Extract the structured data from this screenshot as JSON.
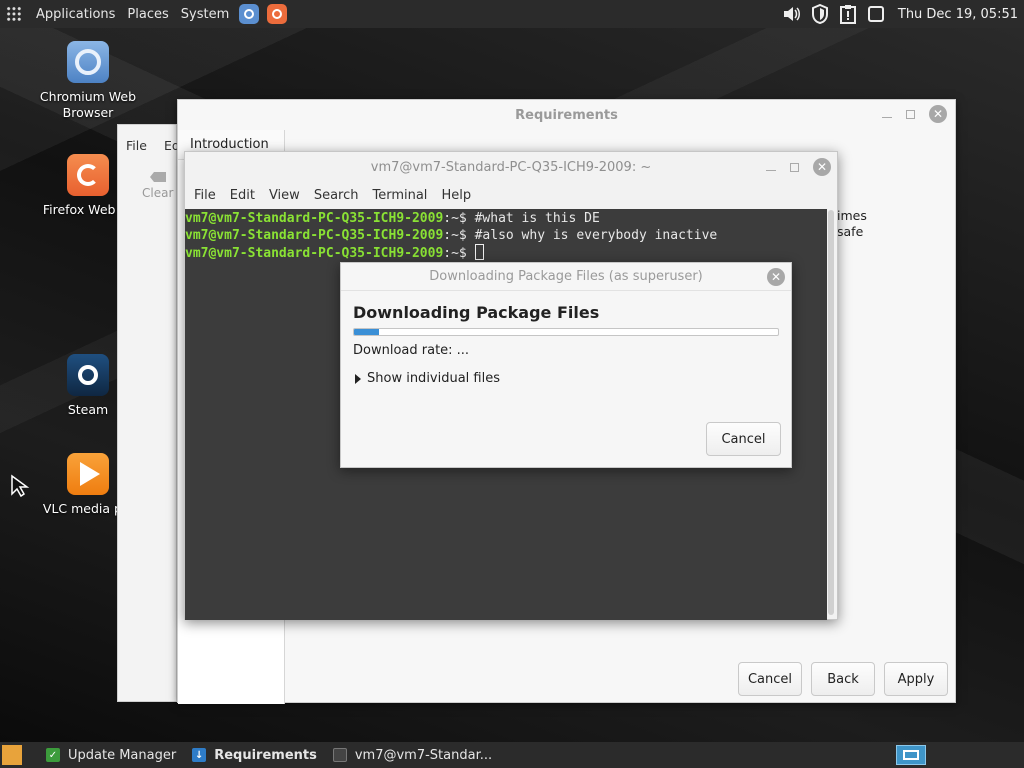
{
  "top_panel": {
    "applications": "Applications",
    "places": "Places",
    "system": "System",
    "launchers": [
      "chromium-icon",
      "firefox-icon"
    ],
    "tray_icons": [
      "volume-icon",
      "shield-icon",
      "update-notifier-icon",
      "window-icon"
    ],
    "clock": "Thu Dec 19, 05:51"
  },
  "desktop_icons": [
    {
      "label": "Chromium Web Browser",
      "icon": "chromium-icon"
    },
    {
      "label": "Firefox Web Br",
      "icon": "firefox-icon"
    },
    {
      "label": "Steam",
      "icon": "steam-icon"
    },
    {
      "label": "VLC media pla",
      "icon": "vlc-icon"
    }
  ],
  "requirements_window": {
    "title": "Requirements",
    "menu": [
      "File",
      "Ed"
    ],
    "clear_label": "Clear",
    "tab": "Introduction",
    "side_text": [
      "imes",
      "safe"
    ],
    "buttons": {
      "cancel": "Cancel",
      "back": "Back",
      "apply": "Apply"
    }
  },
  "terminal": {
    "title": "vm7@vm7-Standard-PC-Q35-ICH9-2009: ~",
    "menu": [
      "File",
      "Edit",
      "View",
      "Search",
      "Terminal",
      "Help"
    ],
    "prompt": "vm7@vm7-Standard-PC-Q35-ICH9-2009",
    "prompt_suffix": ":~$ ",
    "lines": [
      "#what is this DE",
      "#also why is everybody inactive",
      ""
    ]
  },
  "download_dialog": {
    "title": "Downloading Package Files (as superuser)",
    "heading": "Downloading Package Files",
    "progress_fraction": 0.06,
    "rate": "Download rate: ...",
    "expander": "Show individual files",
    "cancel": "Cancel"
  },
  "bottom_panel": {
    "tasks": [
      {
        "label": "Update Manager",
        "icon": "shield-icon",
        "active": false
      },
      {
        "label": "Requirements",
        "icon": "download-icon",
        "active": true
      },
      {
        "label": "vm7@vm7-Standar...",
        "icon": "terminal-icon",
        "active": false
      }
    ]
  },
  "colors": {
    "prompt": "#8ae234",
    "progress": "#3a8fd6",
    "panel": "#2b2b2b"
  }
}
